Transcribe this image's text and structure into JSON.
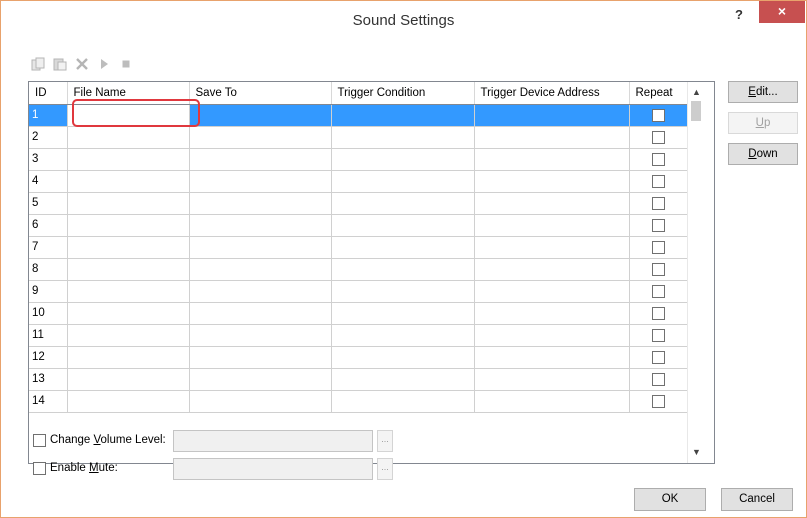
{
  "window": {
    "title": "Sound Settings",
    "help": "?",
    "close": "×"
  },
  "toolbar": {
    "items": [
      {
        "name": "copy-icon"
      },
      {
        "name": "paste-icon"
      },
      {
        "name": "delete-icon"
      },
      {
        "name": "play-icon"
      },
      {
        "name": "stop-icon"
      }
    ]
  },
  "table": {
    "headers": [
      "ID",
      "File Name",
      "Save To",
      "Trigger Condition",
      "Trigger Device Address",
      "Repeat"
    ],
    "rows": [
      {
        "id": "1",
        "file": "",
        "save_to": "",
        "trigger": "",
        "address": "",
        "repeat": false
      },
      {
        "id": "2",
        "file": "",
        "save_to": "",
        "trigger": "",
        "address": "",
        "repeat": false
      },
      {
        "id": "3",
        "file": "",
        "save_to": "",
        "trigger": "",
        "address": "",
        "repeat": false
      },
      {
        "id": "4",
        "file": "",
        "save_to": "",
        "trigger": "",
        "address": "",
        "repeat": false
      },
      {
        "id": "5",
        "file": "",
        "save_to": "",
        "trigger": "",
        "address": "",
        "repeat": false
      },
      {
        "id": "6",
        "file": "",
        "save_to": "",
        "trigger": "",
        "address": "",
        "repeat": false
      },
      {
        "id": "7",
        "file": "",
        "save_to": "",
        "trigger": "",
        "address": "",
        "repeat": false
      },
      {
        "id": "8",
        "file": "",
        "save_to": "",
        "trigger": "",
        "address": "",
        "repeat": false
      },
      {
        "id": "9",
        "file": "",
        "save_to": "",
        "trigger": "",
        "address": "",
        "repeat": false
      },
      {
        "id": "10",
        "file": "",
        "save_to": "",
        "trigger": "",
        "address": "",
        "repeat": false
      },
      {
        "id": "11",
        "file": "",
        "save_to": "",
        "trigger": "",
        "address": "",
        "repeat": false
      },
      {
        "id": "12",
        "file": "",
        "save_to": "",
        "trigger": "",
        "address": "",
        "repeat": false
      },
      {
        "id": "13",
        "file": "",
        "save_to": "",
        "trigger": "",
        "address": "",
        "repeat": false
      },
      {
        "id": "14",
        "file": "",
        "save_to": "",
        "trigger": "",
        "address": "",
        "repeat": false
      }
    ],
    "selected_row": "1"
  },
  "side_buttons": {
    "edit": {
      "label": "Edit...",
      "accel": "E",
      "rest": "dit..."
    },
    "up": {
      "label": "Up",
      "accel": "U",
      "rest": "p"
    },
    "down": {
      "label": "Down",
      "accel": "D",
      "rest": "own"
    }
  },
  "options": {
    "change_volume": {
      "pre": "Change ",
      "accel": "V",
      "post": "olume Level:",
      "value": "",
      "browse": "..."
    },
    "enable_mute": {
      "pre": "Enable ",
      "accel": "M",
      "post": "ute:",
      "value": "",
      "browse": "..."
    }
  },
  "footer": {
    "ok": "OK",
    "cancel": "Cancel"
  },
  "colors": {
    "selection": "#3399ff",
    "close_button": "#c75050",
    "highlight": "#e0383e"
  }
}
